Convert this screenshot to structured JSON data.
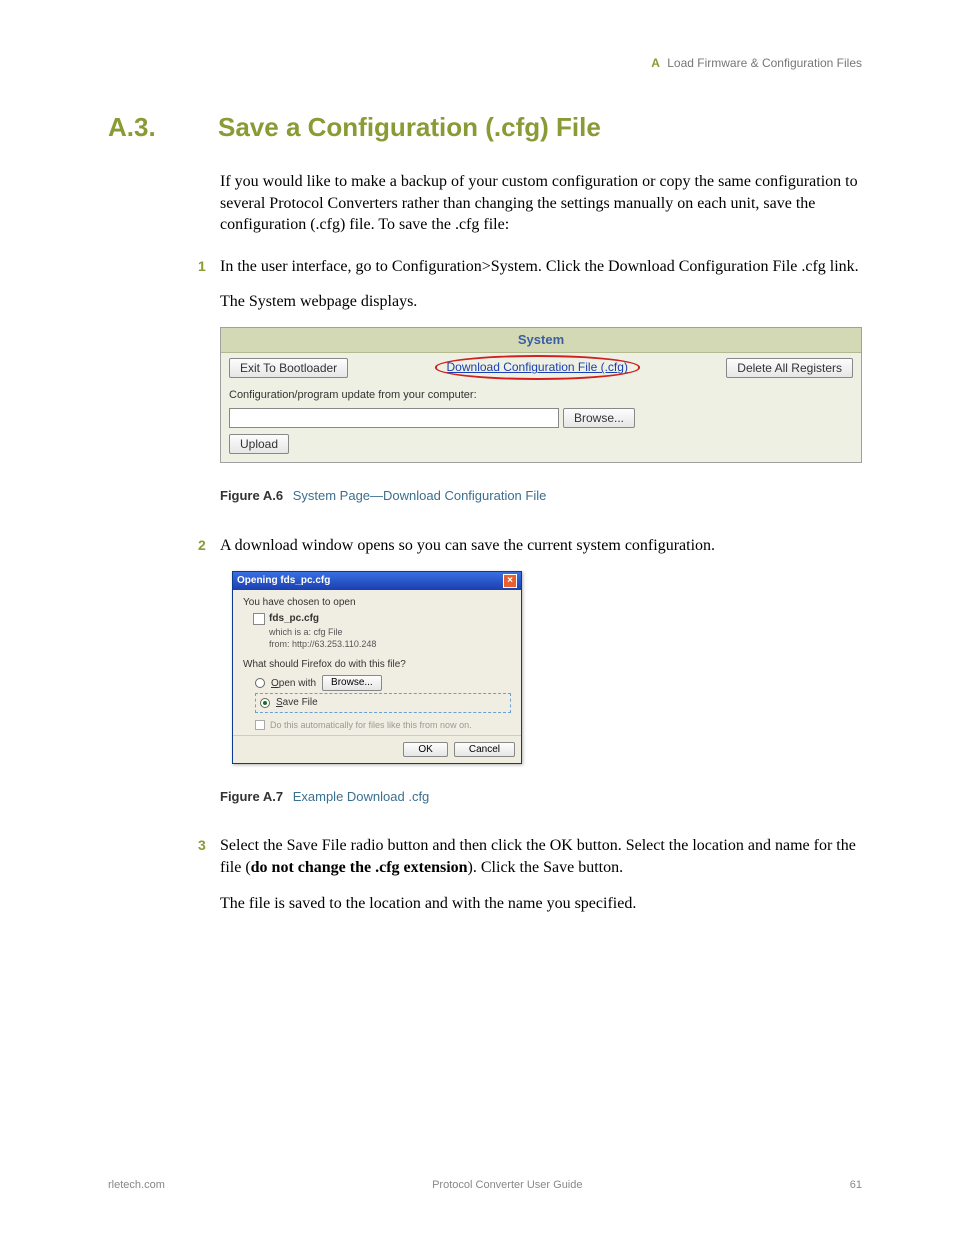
{
  "header": {
    "appendix_letter": "A",
    "appendix_title": "Load Firmware & Configuration Files"
  },
  "section": {
    "number": "A.3.",
    "title": "Save a Configuration (.cfg) File"
  },
  "intro": "If you would like to make a backup of your custom configuration or copy the same configuration to several Protocol Converters rather than changing the settings manually on each unit, save the configuration (.cfg) file. To save the .cfg file:",
  "steps": {
    "s1": {
      "num": "1",
      "text": "In the user interface, go to Configuration>System. Click the Download Configuration File .cfg link.",
      "after": "The System webpage displays."
    },
    "s2": {
      "num": "2",
      "text": "A download window opens so you can save the current system configuration."
    },
    "s3": {
      "num": "3",
      "text_a": "Select the Save File radio button and then click the OK button. Select the location and name for the file (",
      "text_bold": "do not change the .cfg extension",
      "text_b": "). Click the Save button.",
      "after": "The file is saved to the location and with the name you specified."
    }
  },
  "system_panel": {
    "title": "System",
    "exit_btn": "Exit To Bootloader",
    "download_link": "Download Configuration File (.cfg)",
    "delete_btn": "Delete All Registers",
    "update_label": "Configuration/program update from your computer:",
    "browse_btn": "Browse...",
    "upload_btn": "Upload"
  },
  "fig_a6": {
    "label": "Figure A.6",
    "title": "System Page—Download Configuration File"
  },
  "dialog": {
    "title": "Opening fds_pc.cfg",
    "chosen": "You have chosen to open",
    "filename": "fds_pc.cfg",
    "which_is": "which is a: cfg File",
    "from": "from: http://63.253.110.248",
    "question": "What should Firefox do with this file?",
    "open_with": "Open with",
    "browse": "Browse...",
    "save_file": "Save File",
    "auto": "Do this automatically for files like this from now on.",
    "ok": "OK",
    "cancel": "Cancel"
  },
  "fig_a7": {
    "label": "Figure A.7",
    "title": "Example Download .cfg"
  },
  "footer": {
    "left": "rletech.com",
    "center": "Protocol Converter User Guide",
    "right": "61"
  }
}
